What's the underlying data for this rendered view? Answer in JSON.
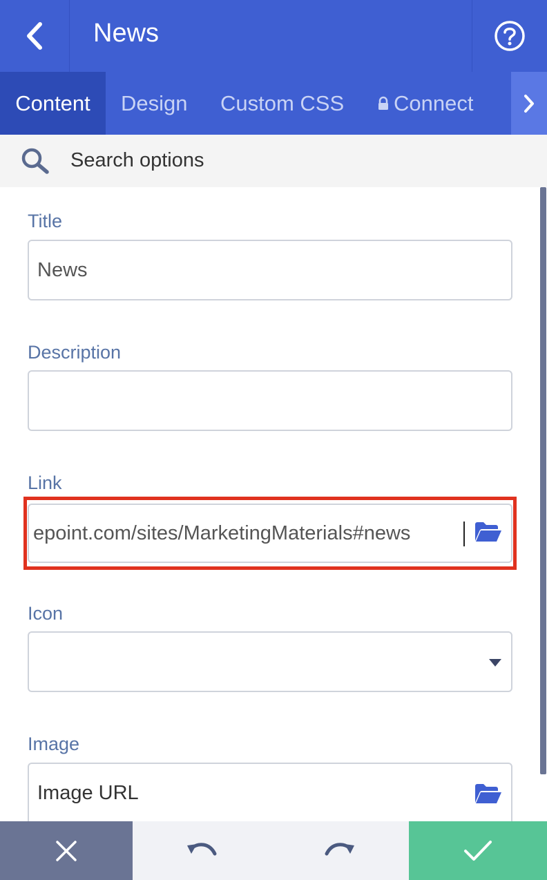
{
  "header": {
    "title": "News",
    "back_icon": "chevron-left-icon",
    "help_icon": "question-circle-icon"
  },
  "tabs": [
    {
      "label": "Content",
      "active": true
    },
    {
      "label": "Design",
      "active": false
    },
    {
      "label": "Custom CSS",
      "active": false
    },
    {
      "label": "Connect",
      "active": false,
      "icon": "lock-icon"
    }
  ],
  "search": {
    "placeholder": "Search options"
  },
  "form": {
    "title_label": "Title",
    "title_value": "News",
    "description_label": "Description",
    "description_value": "",
    "link_label": "Link",
    "link_value": "epoint.com/sites/MarketingMaterials#news",
    "icon_label": "Icon",
    "icon_value": "",
    "image_label": "Image",
    "image_value": "Image URL"
  },
  "footer": {
    "cancel_icon": "close-icon",
    "undo_icon": "undo-icon",
    "redo_icon": "redo-icon",
    "confirm_icon": "check-icon"
  },
  "colors": {
    "header": "#3f5fd2",
    "active_tab": "#2d4bb6",
    "label": "#5874a6",
    "highlight": "#e0321f",
    "cancel": "#6a7494",
    "confirm": "#57c596"
  }
}
